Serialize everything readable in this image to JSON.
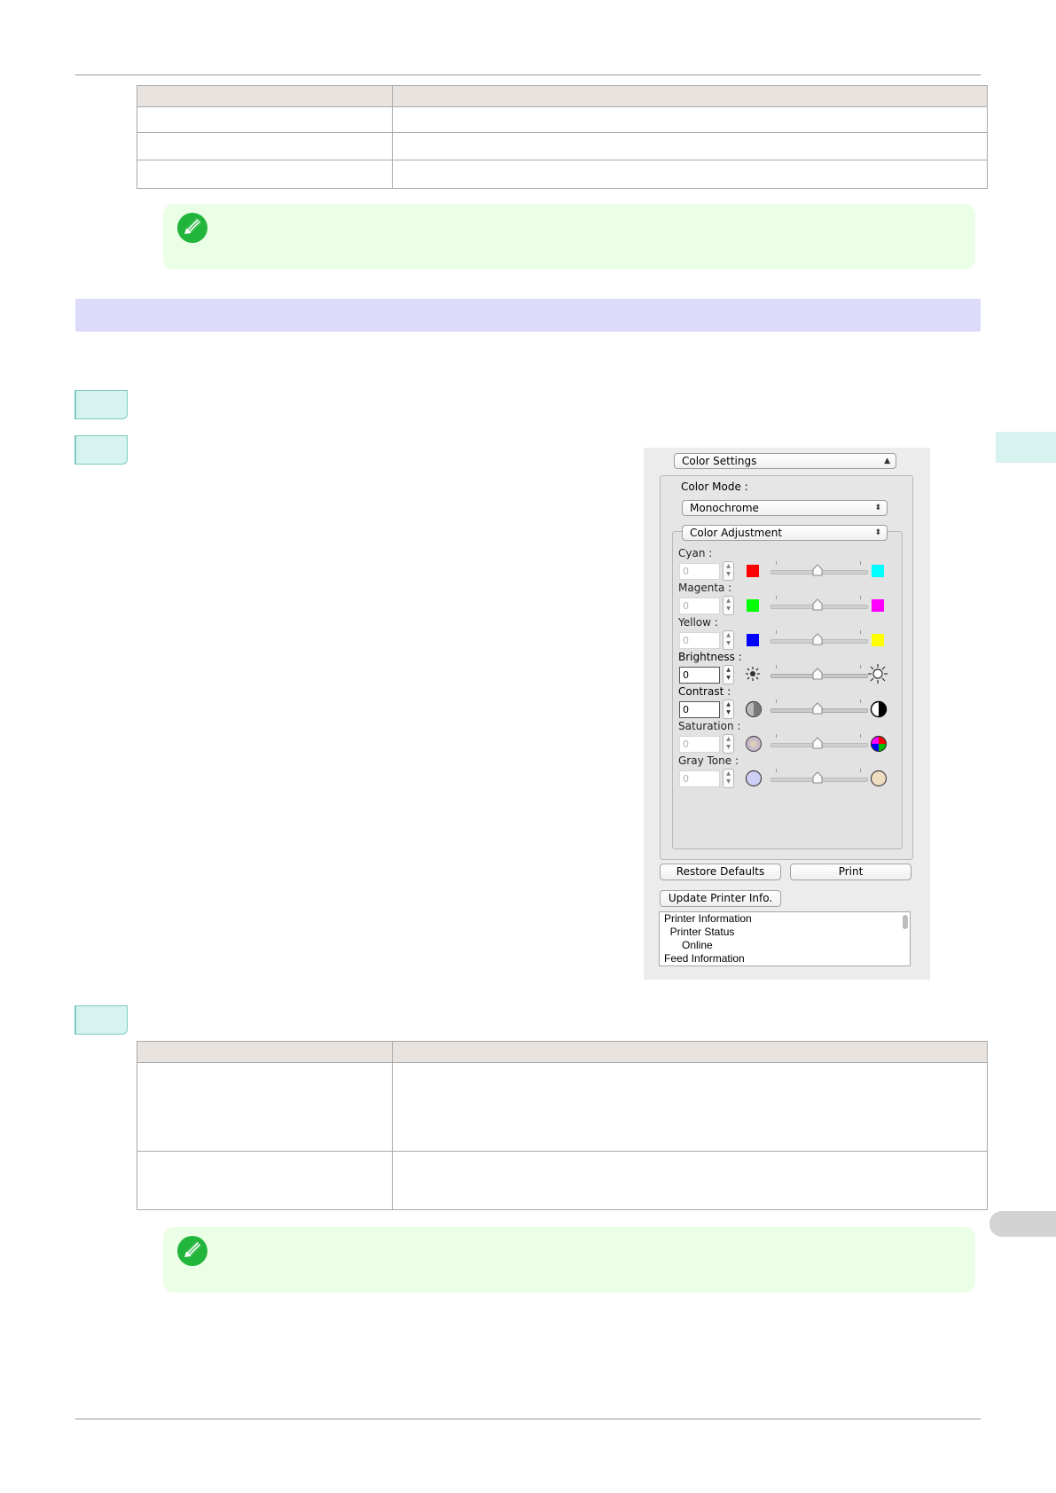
{
  "dialog": {
    "settings_popup": "Color Settings",
    "color_mode_label": "Color Mode :",
    "color_mode_value": "Monochrome",
    "adjust_popup": "Color Adjustment",
    "controls": [
      {
        "label": "Cyan :",
        "value": "0",
        "enabled": false,
        "left_swatch": "#ff0000",
        "right_swatch": "#00ffff"
      },
      {
        "label": "Magenta :",
        "value": "0",
        "enabled": false,
        "left_swatch": "#00ff00",
        "right_swatch": "#ff00ff"
      },
      {
        "label": "Yellow :",
        "value": "0",
        "enabled": false,
        "left_swatch": "#0000ff",
        "right_swatch": "#ffff00"
      },
      {
        "label": "Brightness :",
        "value": "0",
        "enabled": true,
        "left_icon": "sun-dim-icon",
        "right_icon": "sun-bright-icon"
      },
      {
        "label": "Contrast :",
        "value": "0",
        "enabled": true,
        "left_icon": "contrast-low-icon",
        "right_icon": "contrast-high-icon"
      },
      {
        "label": "Saturation :",
        "value": "0",
        "enabled": false,
        "left_icon": "saturation-low-icon",
        "right_icon": "saturation-high-icon"
      },
      {
        "label": "Gray Tone :",
        "value": "0",
        "enabled": false,
        "left_icon": "gray-cool-icon",
        "right_icon": "gray-warm-icon"
      }
    ],
    "restore_defaults": "Restore Defaults",
    "print": "Print",
    "update_printer_info": "Update Printer Info.",
    "printer_info_lines": [
      "Printer Information",
      "  Printer Status",
      "      Online",
      "Feed Information"
    ]
  },
  "colors": {
    "table_header": "#e8e3de",
    "note_bg": "#eaffe5",
    "section_bar": "#dcdcfa",
    "step_box": "#d7f3ef"
  }
}
